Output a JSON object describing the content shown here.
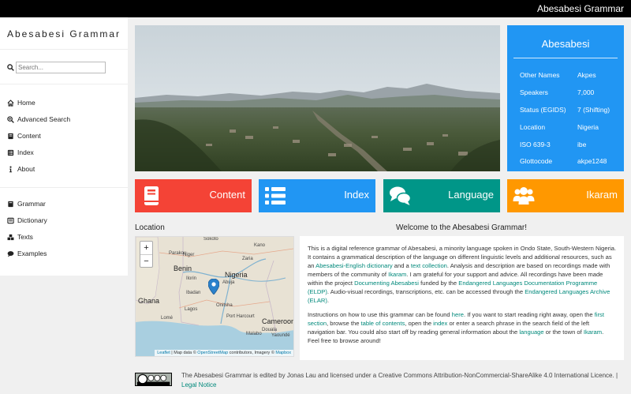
{
  "header": {
    "brand": "Abesabesi Grammar"
  },
  "sidebar": {
    "title": "Abesabesi Grammar",
    "search_placeholder": "Search...",
    "nav": [
      {
        "label": "Home",
        "icon": "home-icon"
      },
      {
        "label": "Advanced Search",
        "icon": "search-plus-icon"
      },
      {
        "label": "Content",
        "icon": "book-icon"
      },
      {
        "label": "Index",
        "icon": "list-icon"
      },
      {
        "label": "About",
        "icon": "info-icon"
      }
    ],
    "nav2": [
      {
        "label": "Grammar",
        "icon": "book-icon"
      },
      {
        "label": "Dictionary",
        "icon": "dictionary-icon"
      },
      {
        "label": "Texts",
        "icon": "boxes-icon"
      },
      {
        "label": "Examples",
        "icon": "comment-icon"
      }
    ]
  },
  "infobox": {
    "title": "Abesabesi",
    "rows": [
      {
        "key": "Other Names",
        "value": "Akpes"
      },
      {
        "key": "Speakers",
        "value": "7,000"
      },
      {
        "key": "Status (EGIDS)",
        "value": "7 (Shifting)"
      },
      {
        "key": "Location",
        "value": "Nigeria"
      },
      {
        "key": "ISO 639-3",
        "value": "ibe"
      },
      {
        "key": "Glottocode",
        "value": "akpe1248"
      }
    ]
  },
  "tiles": [
    {
      "label": "Content",
      "icon": "book-icon",
      "color": "#f44336"
    },
    {
      "label": "Index",
      "icon": "list-icon",
      "color": "#2196f3"
    },
    {
      "label": "Language",
      "icon": "comments-icon",
      "color": "#009688"
    },
    {
      "label": "Ikaram",
      "icon": "users-icon",
      "color": "#ff9800"
    }
  ],
  "location": {
    "label": "Location",
    "zoom_in": "+",
    "zoom_out": "−",
    "map_labels": [
      "Sokoto",
      "Kano",
      "Niger",
      "Zaria",
      "Nigeria",
      "Benin",
      "Ilorin",
      "Abuja",
      "Ibadan",
      "Lagos",
      "Onitsha",
      "Ghana",
      "Port Harcourt",
      "Cameroon",
      "Lomé",
      "Yaoundé",
      "Malabo",
      "Douala",
      "Parakou"
    ],
    "attribution": {
      "leaflet": "Leaflet",
      "sep1": " | Map data © ",
      "osm": "OpenStreetMap",
      "mid": " contributors, Imagery © ",
      "mapbox": "Mapbox"
    }
  },
  "welcome": {
    "title": "Welcome to the Abesabesi Grammar!",
    "p1": {
      "t1": "This is a digital reference grammar of Abesabesi, a minority language spoken in Ondo State, South-Western Nigeria. It contains a grammatical description of the language on different linguistic levels and additional resources, such as an ",
      "l1": "Abesabesi-English dictionary",
      "t2": " and a ",
      "l2": "text collection",
      "t3": ". Analysis and description are based on recordings made with members of the community of ",
      "l3": "Ikaram",
      "t4": ". I am grateful for your support and advice. All recordings have been made within the project ",
      "l4": "Documenting Abesabesi",
      "t5": " funded by the ",
      "l5": "Endangered Languages Documentation Programme (ELDP)",
      "t6": ". Audio-visual recordings, transcriptions, etc. can be accessed through the ",
      "l6": "Endangered Languages Archive (ELAR)",
      "t7": "."
    },
    "p2": {
      "t1": "Instructions on how to use this grammar can be found ",
      "l1": "here",
      "t2": ". If you want to start reading right away, open the ",
      "l2": "first section",
      "t3": ", browse the ",
      "l3": "table of contents",
      "t4": ", open the ",
      "l4": "index",
      "t5": " or enter a search phrase in the search field of the left navigation bar. You could also start off by reading general information about the ",
      "l5": "language",
      "t6": " or the town of ",
      "l6": "Ikaram",
      "t7": ". Feel free to browse around!"
    }
  },
  "footer": {
    "text": "The Abesabesi Grammar is edited by Jonas Lau and licensed under a Creative Commons Attribution-NonCommercial-ShareAlike 4.0 International Licence. | ",
    "legal": "Legal Notice"
  },
  "colors": {
    "accent": "#2196f3",
    "link": "#00897b"
  }
}
